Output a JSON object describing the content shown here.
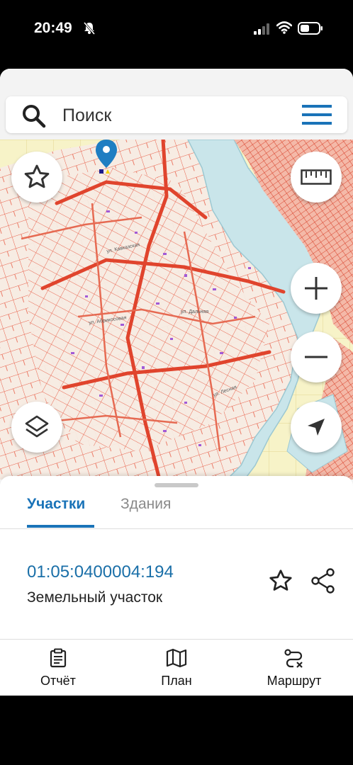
{
  "status_bar": {
    "time": "20:49"
  },
  "search": {
    "placeholder": "Поиск"
  },
  "map": {
    "street_labels": [
      "ул. Кавказская",
      "ул. Абрикосовая",
      "ул. Дальняя",
      "ул. Лесная"
    ]
  },
  "tabs": [
    {
      "label": "Участки",
      "active": true
    },
    {
      "label": "Здания",
      "active": false
    }
  ],
  "parcel": {
    "cadastral_number": "01:05:0400004:194",
    "type": "Земельный участок"
  },
  "bottom_nav": [
    {
      "label": "Отчёт",
      "icon": "report-icon"
    },
    {
      "label": "План",
      "icon": "map-plan-icon"
    },
    {
      "label": "Маршрут",
      "icon": "route-icon"
    }
  ],
  "colors": {
    "accent": "#1a73b8",
    "parcel_lines": "#e8604a",
    "water": "#c9e5ea",
    "pin": "#1f7ec2"
  }
}
